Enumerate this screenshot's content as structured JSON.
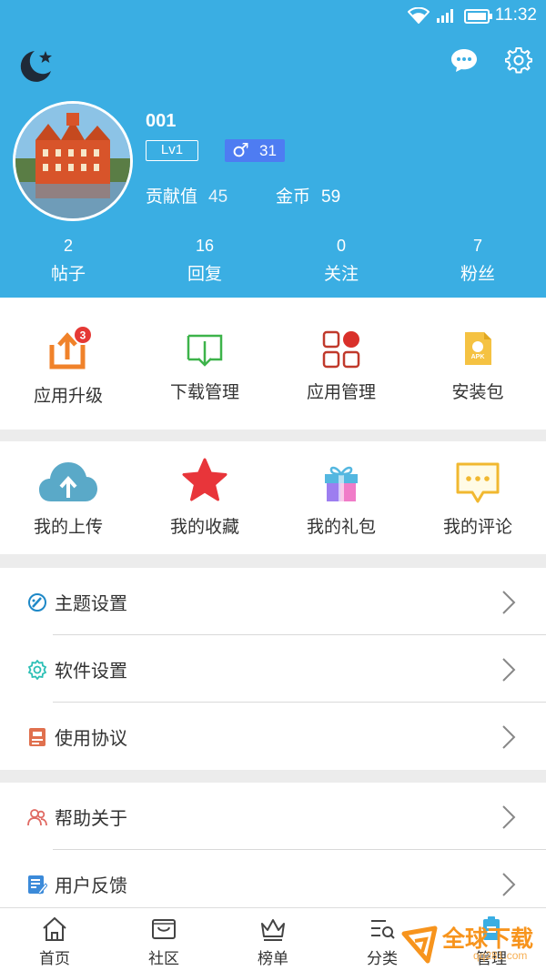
{
  "status_bar": {
    "time": "11:32"
  },
  "profile": {
    "username": "001",
    "level": "Lv1",
    "gender_symbol": "♂",
    "gender_value": "31",
    "contribution_label": "贡献值",
    "contribution_value": "45",
    "coins_label": "金币",
    "coins_value": "59"
  },
  "stats": [
    {
      "value": "2",
      "label": "帖子"
    },
    {
      "value": "16",
      "label": "回复"
    },
    {
      "value": "0",
      "label": "关注"
    },
    {
      "value": "7",
      "label": "粉丝"
    }
  ],
  "tools": [
    {
      "label": "应用升级",
      "icon": "upload-box-icon",
      "badge": "3"
    },
    {
      "label": "下载管理",
      "icon": "download-icon"
    },
    {
      "label": "应用管理",
      "icon": "apps-grid-icon"
    },
    {
      "label": "安装包",
      "icon": "apk-icon"
    }
  ],
  "personal": [
    {
      "label": "我的上传",
      "icon": "cloud-upload-icon"
    },
    {
      "label": "我的收藏",
      "icon": "star-icon"
    },
    {
      "label": "我的礼包",
      "icon": "gift-icon"
    },
    {
      "label": "我的评论",
      "icon": "comment-icon"
    }
  ],
  "settings": [
    {
      "label": "主题设置",
      "icon": "theme-icon"
    },
    {
      "label": "软件设置",
      "icon": "settings-icon"
    },
    {
      "label": "使用协议",
      "icon": "agreement-icon"
    },
    {
      "label": "帮助关于",
      "icon": "help-icon"
    },
    {
      "label": "用户反馈",
      "icon": "feedback-icon"
    }
  ],
  "bottom_nav": [
    {
      "label": "首页",
      "icon": "home-icon"
    },
    {
      "label": "社区",
      "icon": "community-icon"
    },
    {
      "label": "榜单",
      "icon": "crown-icon"
    },
    {
      "label": "分类",
      "icon": "category-icon"
    },
    {
      "label": "管理",
      "icon": "manage-icon"
    }
  ],
  "watermark": {
    "title": "全球下载",
    "site": "qq281.com"
  },
  "colors": {
    "header_bg": "#3aaee3",
    "gender_badge": "#4e7cf2",
    "badge_red": "#e53935",
    "accent_orange": "#f7941d"
  }
}
